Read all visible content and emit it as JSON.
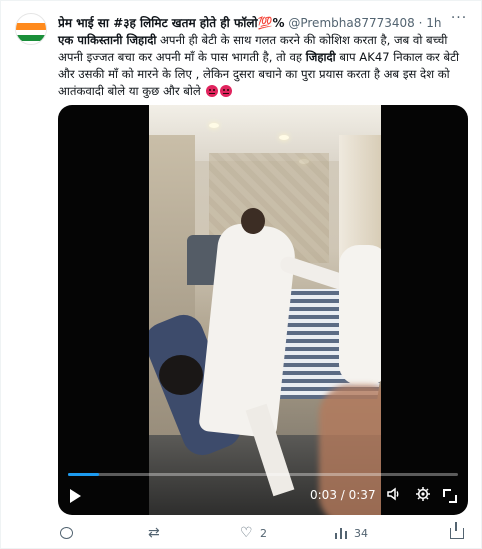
{
  "post": {
    "display_name": "प्रेम भाई सा #३ह लिमिट खतम होते ही फॉलो💯%",
    "handle": "@Prembha87773408",
    "separator": "·",
    "time": "1h",
    "text_segments": [
      {
        "text": "एक पाकिस्तानी जिहादी",
        "bold": true
      },
      {
        "text": " अपनी ही बेटी के साथ गलत करने की कोशिश करता है, जब वो बच्ची अपनी इज्जत बचा कर अपनी माँ के पास भागती है, तो वह ",
        "bold": false
      },
      {
        "text": "जिहादी",
        "bold": true
      },
      {
        "text": " बाप AK47 निकाल कर बेटी और उसकी माँ को मारने के लिए , लेकिन दुसरा बचाने का पुरा प्रयास करता है अब इस देश को आतंकवादी बोले या कुछ और बोले",
        "bold": false
      }
    ],
    "emoji": [
      "angry-face",
      "angry-face"
    ]
  },
  "video": {
    "current_time": "0:03",
    "duration": "0:37",
    "time_separator": " / ",
    "progress_fraction": 0.08
  },
  "actions": {
    "reply_count": "",
    "retweet_count": "",
    "like_count": "2",
    "views_count": "34"
  },
  "colors": {
    "text": "#0f1419",
    "secondary": "#536471",
    "accent": "#1d9bf0",
    "emoji": "#e0245e"
  }
}
